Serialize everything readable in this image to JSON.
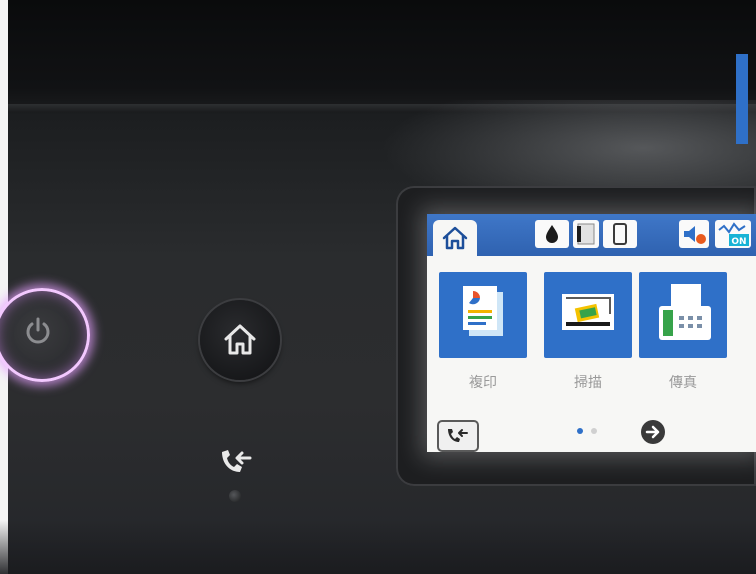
{
  "printer_panel": {
    "buttons": {
      "power": "power-icon",
      "home": "home-icon",
      "fax_indicator": "fax-receive-icon"
    }
  },
  "lcd": {
    "status_bar": {
      "icons": [
        "home-icon",
        "ink-drop-icon",
        "paper-icon",
        "phone-icon",
        "speaker-icon",
        "wifi-on-icon"
      ],
      "wifi_badge": "ON"
    },
    "apps": [
      {
        "label": "複印",
        "icon": "copy-icon"
      },
      {
        "label": "掃描",
        "icon": "scan-icon"
      },
      {
        "label": "傳真",
        "icon": "fax-icon"
      }
    ],
    "pagination": {
      "current": 1,
      "total": 2
    },
    "bottom": {
      "fax_log_icon": "fax-log-icon",
      "next_icon": "arrow-right-icon"
    }
  },
  "colors": {
    "accent_blue": "#2f70c8",
    "power_glow": "#f3c8ff",
    "screen_bg": "#f7f7f5"
  }
}
